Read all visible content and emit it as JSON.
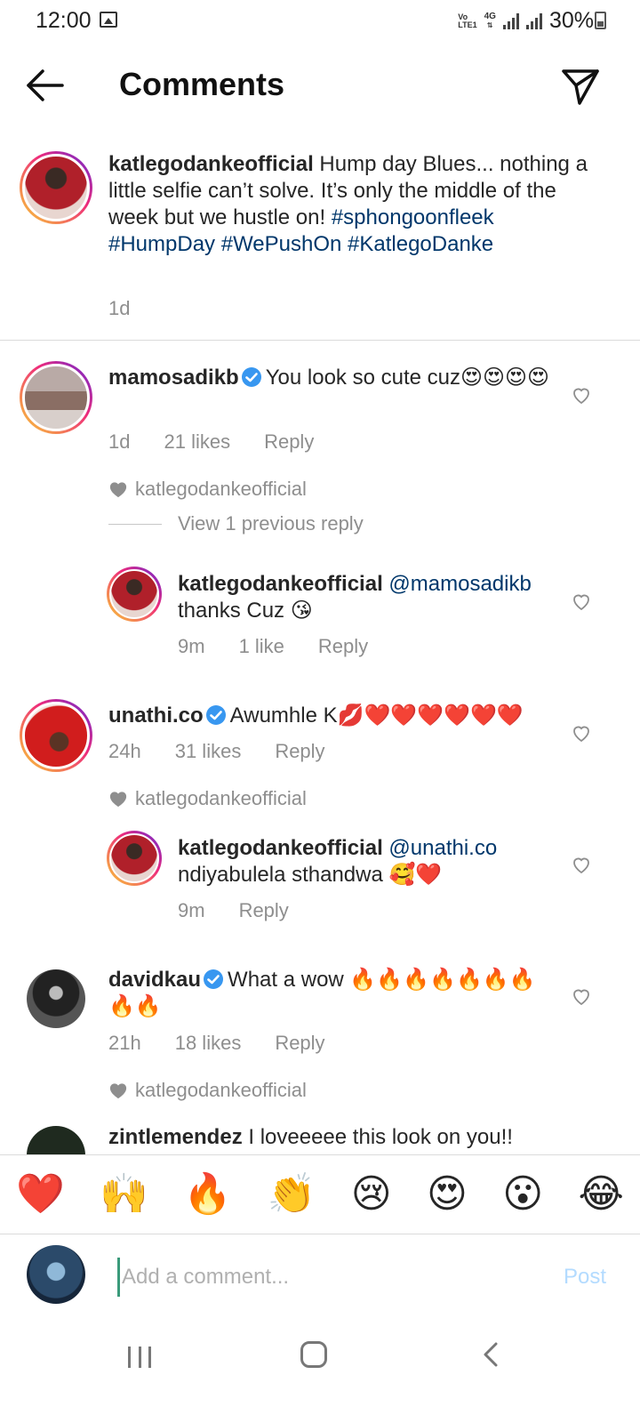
{
  "status_bar": {
    "time": "12:00",
    "volte_top": "Vo",
    "volte_bottom": "LTE1",
    "network": "4G",
    "battery": "30%"
  },
  "header": {
    "title": "Comments",
    "back_icon": "arrow-left-icon",
    "share_icon": "paper-plane-icon"
  },
  "caption": {
    "username": "katlegodankeofficial",
    "text": "Hump day Blues... nothing a little selfie can’t solve. It’s only the middle of the week but we hustle on!",
    "hashtags": [
      "#sphongoonfleek",
      "#HumpDay",
      "#WePushOn",
      "#KatlegoDanke"
    ],
    "time": "1d"
  },
  "comments": [
    {
      "username": "mamosadikb",
      "verified": true,
      "text": "You look so cute cuz😍😍😍😍",
      "time": "1d",
      "likes": "21 likes",
      "reply_label": "Reply",
      "liked_by": "katlegodankeofficial",
      "view_replies": "View 1 previous reply",
      "reply": {
        "username": "katlegodankeofficial",
        "mention": "@mamosadikb",
        "text": "thanks Cuz 😘",
        "time": "9m",
        "likes": "1 like",
        "reply_label": "Reply"
      }
    },
    {
      "username": "unathi.co",
      "verified": true,
      "text": "Awumhle K💋❤️❤️❤️❤️❤️❤️",
      "time": "24h",
      "likes": "31 likes",
      "reply_label": "Reply",
      "liked_by": "katlegodankeofficial",
      "reply": {
        "username": "katlegodankeofficial",
        "mention": "@unathi.co",
        "text": "ndiyabulela sthandwa 🥰❤️",
        "time": "9m",
        "reply_label": "Reply"
      }
    },
    {
      "username": "davidkau",
      "verified": true,
      "text": "What a wow 🔥🔥🔥🔥🔥🔥🔥🔥🔥",
      "time": "21h",
      "likes": "18 likes",
      "reply_label": "Reply",
      "liked_by": "katlegodankeofficial"
    },
    {
      "username": "zintlemendez",
      "text": "I loveeeee this look on you!!"
    }
  ],
  "emoji_bar": [
    "❤️",
    "🙌",
    "🔥",
    "👏",
    "😢",
    "😍",
    "😮",
    "😂"
  ],
  "comment_input": {
    "placeholder": "Add a comment...",
    "post_label": "Post"
  },
  "colors": {
    "link": "#00376b",
    "meta": "#8e8e8e",
    "post_disabled": "#b3dbff",
    "verified": "#3897f0"
  }
}
